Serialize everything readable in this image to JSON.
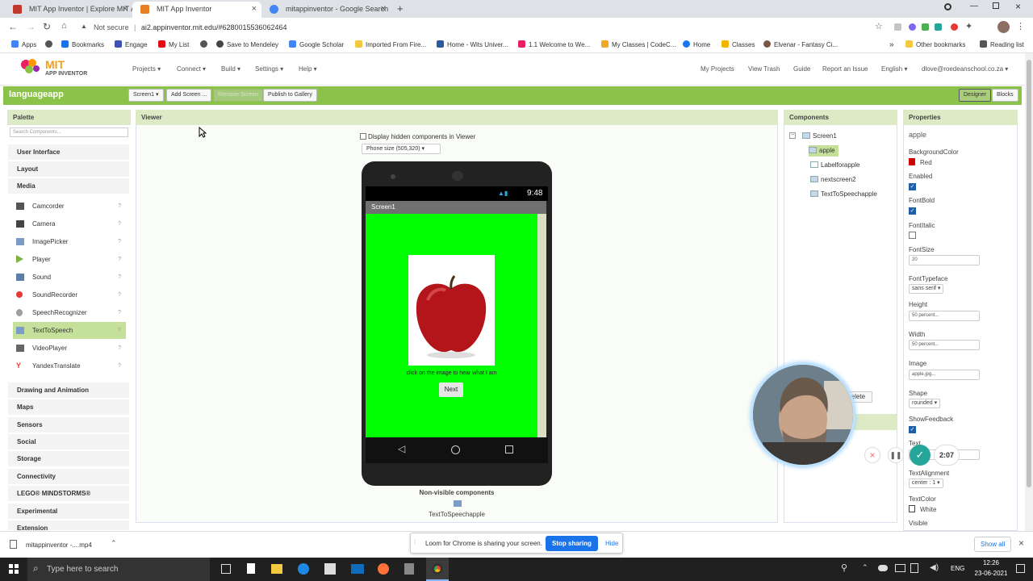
{
  "browser": {
    "tabs": [
      {
        "label": "MIT App Inventor | Explore MIT A...",
        "fav": "#c0392b"
      },
      {
        "label": "MIT App Inventor",
        "fav": "#e67e22"
      },
      {
        "label": "mitappinventor - Google Search",
        "fav": "#4285f4"
      }
    ],
    "new_tab": "+",
    "security": "Not secure",
    "url": "ai2.appinventor.mit.edu/#6280015536062464",
    "bookmarks": [
      "Apps",
      "Bookmarks",
      "Engage",
      "My List",
      "Save to Mendeley",
      "Google Scholar",
      "Imported From Fire...",
      "Home - Wits Univer...",
      "1.1 Welcome to We...",
      "My Classes | CodeC...",
      "Home",
      "Classes",
      "Elvenar - Fantasy Ci..."
    ],
    "other_bookmarks": "Other bookmarks",
    "reading_list": "Reading list"
  },
  "app": {
    "logo_top": "MIT",
    "logo_bottom": "APP INVENTOR",
    "menus": [
      "Projects ▾",
      "Connect ▾",
      "Build ▾",
      "Settings ▾",
      "Help ▾"
    ],
    "right_links": [
      "My Projects",
      "View Trash",
      "Guide",
      "Report an Issue",
      "English ▾",
      "dlove@roedeanschool.co.za ▾"
    ],
    "project": "languageapp",
    "toolbar": [
      "Screen1 ▾",
      "Add Screen ...",
      "Remove Screen",
      "Publish to Gallery"
    ],
    "modes": [
      "Designer",
      "Blocks"
    ]
  },
  "palette": {
    "title": "Palette",
    "search_placeholder": "Search Components...",
    "top_cats": [
      "User Interface",
      "Layout",
      "Media"
    ],
    "media": [
      {
        "label": "Camcorder",
        "color": "#555"
      },
      {
        "label": "Camera",
        "color": "#444"
      },
      {
        "label": "ImagePicker",
        "color": "#7a9cc6"
      },
      {
        "label": "Player",
        "color": "#7cb342"
      },
      {
        "label": "Sound",
        "color": "#5b7fa8"
      },
      {
        "label": "SoundRecorder",
        "color": "#e53935"
      },
      {
        "label": "SpeechRecognizer",
        "color": "#9e9e9e"
      },
      {
        "label": "TextToSpeech",
        "color": "#7a9cc6"
      },
      {
        "label": "VideoPlayer",
        "color": "#666"
      },
      {
        "label": "YandexTranslate",
        "color": "#e53935"
      }
    ],
    "help": "?",
    "bottom_cats": [
      "Drawing and Animation",
      "Maps",
      "Sensors",
      "Social",
      "Storage",
      "Connectivity",
      "LEGO® MINDSTORMS®",
      "Experimental",
      "Extension"
    ]
  },
  "viewer": {
    "title": "Viewer",
    "hidden_label": "Display hidden components in Viewer",
    "phone_size": "Phone size (505,320) ▾",
    "time": "9:48",
    "screen_title": "Screen1",
    "caption": "click on the image to hear what I am",
    "next": "Next",
    "nonvisible_title": "Non-visible components",
    "nonvisible_item": "TextToSpeechapple",
    "screen_color": "#00ff00"
  },
  "components": {
    "title": "Components",
    "root": "Screen1",
    "items": [
      "apple",
      "Labelforapple",
      "nextscreen2",
      "TextToSpeechapple"
    ],
    "delete": "Delete"
  },
  "properties": {
    "title": "Properties",
    "component": "apple",
    "bg_label": "BackgroundColor",
    "bg_value": "Red",
    "enabled": "Enabled",
    "fontbold": "FontBold",
    "fontitalic": "FontItalic",
    "fontsize": "FontSize",
    "fontsize_val": "20",
    "typeface": "FontTypeface",
    "typeface_val": "sans serif ▾",
    "height": "Height",
    "height_val": "50 percent...",
    "width": "Width",
    "width_val": "50 percent...",
    "image": "Image",
    "image_val": "apple.jpg...",
    "shape": "Shape",
    "shape_val": "rounded ▾",
    "showfeedback": "ShowFeedback",
    "text": "Text",
    "text_val": "...",
    "align": "TextAlignment",
    "align_val": "center : 1 ▾",
    "textcolor": "TextColor",
    "textcolor_val": "White",
    "visible": "Visible"
  },
  "recording": {
    "timer": "2:07"
  },
  "download": {
    "file": "mitappinventor -....mp4",
    "show_all": "Show all"
  },
  "loom": {
    "msg": "Loom for Chrome is sharing your screen.",
    "stop": "Stop sharing",
    "hide": "Hide"
  },
  "taskbar": {
    "search": "Type here to search",
    "lang": "ENG",
    "time": "12:26",
    "date": "23-06-2021"
  }
}
